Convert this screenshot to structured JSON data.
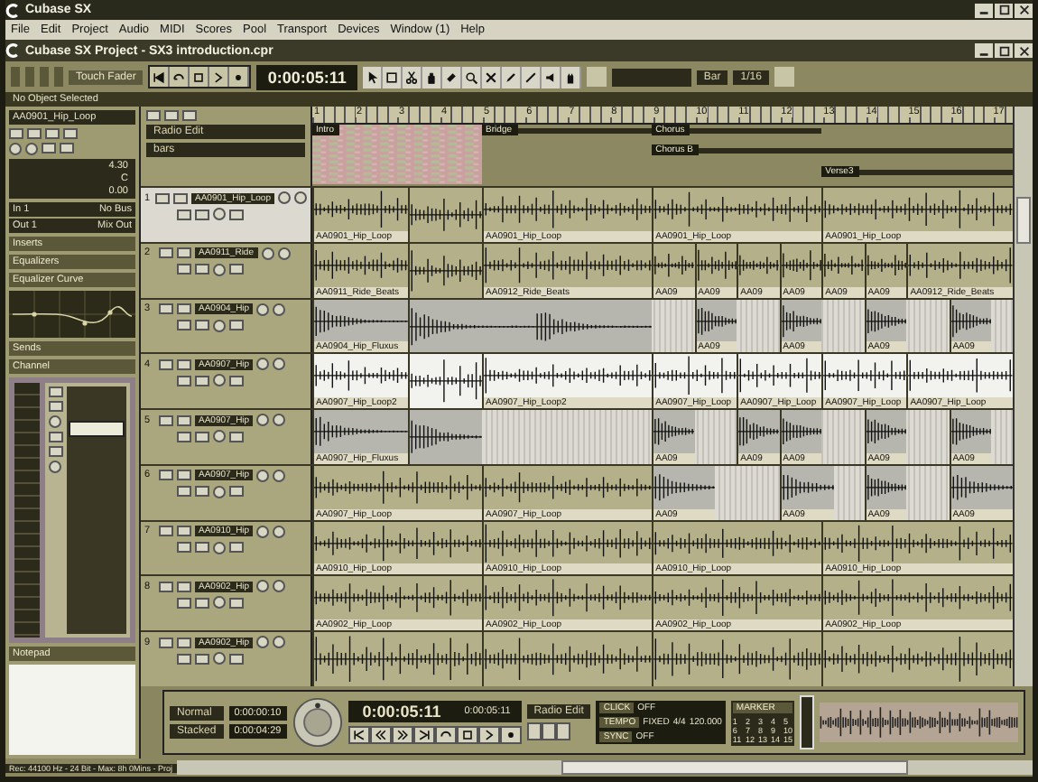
{
  "app_window": {
    "title": "Cubase SX"
  },
  "menu": [
    "File",
    "Edit",
    "Project",
    "Audio",
    "MIDI",
    "Scores",
    "Pool",
    "Transport",
    "Devices",
    "Window (1)",
    "Help"
  ],
  "project_window": {
    "title": "Cubase SX Project - SX3 introduction.cpr"
  },
  "toolbar": {
    "automation_mode": "Touch Fader",
    "time_display": "0:00:05:11",
    "grid_type": "Bar",
    "quantize": "1/16"
  },
  "info_line": "No Object Selected",
  "inspector": {
    "track_name": "AA0901_Hip_Loop",
    "volume": "4.30",
    "pan": "C",
    "delay": "0.00",
    "input": "In 1",
    "input_bus": "No Bus",
    "output": "Out 1",
    "output_bus": "Mix Out",
    "sections": [
      {
        "label": "Inserts",
        "kind": "section"
      },
      {
        "label": "Equalizers",
        "kind": "section"
      },
      {
        "label": "Equalizer Curve",
        "kind": "curve"
      },
      {
        "label": "Sends",
        "kind": "section"
      },
      {
        "label": "Channel",
        "kind": "channel"
      }
    ],
    "fader": {
      "level": 0.85
    },
    "notepad": "Notepad"
  },
  "track_list_header": {
    "preset": "Radio Edit",
    "zoom": "bars"
  },
  "ruler": [
    "1",
    "2",
    "3",
    "4",
    "5",
    "6",
    "7",
    "8",
    "9",
    "10",
    "11",
    "12",
    "13",
    "14",
    "15",
    "16",
    "17"
  ],
  "marker_rows": [
    [
      {
        "label": "Intro",
        "kind": "cycle"
      },
      {
        "label": "Bridge",
        "kind": "marker"
      },
      {
        "label": "Chorus",
        "kind": "marker"
      }
    ],
    [
      {
        "label": "Chorus B",
        "kind": "marker"
      }
    ],
    [
      {
        "label": "Verse3",
        "kind": "marker"
      }
    ]
  ],
  "tracks": [
    {
      "number": "1",
      "name": "AA0901_Hip_Loop",
      "selected": true,
      "events": [
        {
          "label": "AA0901_Hip_Loop",
          "kind": "loop",
          "selected": false
        },
        {
          "kind": "loop",
          "selected": false
        },
        {
          "label": "AA0901_Hip_Loop",
          "kind": "loop",
          "selected": false
        },
        {
          "label": "AA0901_Hip_Loop",
          "kind": "loop",
          "selected": false
        },
        {
          "label": "AA0901_Hip_Loop",
          "kind": "loop",
          "selected": false
        }
      ]
    },
    {
      "number": "2",
      "name": "AA0911_Ride",
      "selected": false,
      "events": [
        {
          "label": "AA0911_Ride_Beats",
          "kind": "loop",
          "selected": false
        },
        {
          "kind": "loop",
          "selected": false
        },
        {
          "label": "AA0912_Ride_Beats",
          "kind": "loop",
          "selected": false
        },
        {
          "label": "AA09",
          "kind": "loop",
          "selected": false
        },
        {
          "label": "AA09",
          "kind": "loop",
          "selected": false
        },
        {
          "label": "AA09",
          "kind": "loop",
          "selected": false
        },
        {
          "label": "AA09",
          "kind": "loop",
          "selected": false
        },
        {
          "label": "AA09",
          "kind": "loop",
          "selected": false
        },
        {
          "label": "AA09",
          "kind": "loop",
          "selected": false
        },
        {
          "label": "AA0912_Ride_Beats",
          "kind": "loop",
          "selected": false
        }
      ]
    },
    {
      "number": "3",
      "name": "AA0904_Hip",
      "selected": false,
      "events": [
        {
          "label": "AA0904_Hip_Fluxus",
          "kind": "hit",
          "selected": false
        },
        {
          "kind": "hit",
          "selected": false
        },
        {
          "label": "AA09",
          "kind": "hit",
          "selected": false
        },
        {
          "label": "AA09",
          "kind": "hit",
          "selected": false
        },
        {
          "label": "AA09",
          "kind": "hit",
          "selected": false
        },
        {
          "label": "AA09",
          "kind": "hit",
          "selected": false
        }
      ]
    },
    {
      "number": "4",
      "name": "AA0907_Hip",
      "selected": false,
      "events": [
        {
          "label": "AA0907_Hip_Loop2",
          "kind": "loop",
          "selected": true
        },
        {
          "kind": "loop",
          "selected": true
        },
        {
          "label": "AA0907_Hip_Loop2",
          "kind": "loop",
          "selected": true
        },
        {
          "label": "AA0907_Hip_Loop",
          "kind": "loop",
          "selected": true
        },
        {
          "label": "AA0907_Hip_Loop",
          "kind": "loop",
          "selected": true
        },
        {
          "label": "AA0907_Hip_Loop",
          "kind": "loop",
          "selected": true
        },
        {
          "label": "AA0907_Hip_Loop",
          "kind": "loop",
          "selected": true
        }
      ]
    },
    {
      "number": "5",
      "name": "AA0907_Hip",
      "selected": false,
      "events": [
        {
          "label": "AA0907_Hip_Fluxus",
          "kind": "hit",
          "selected": false
        },
        {
          "kind": "hit",
          "selected": false
        },
        {
          "label": "AA09",
          "kind": "hit",
          "selected": false
        },
        {
          "label": "AA09",
          "kind": "hit",
          "selected": false
        },
        {
          "label": "AA09",
          "kind": "hit",
          "selected": false
        },
        {
          "label": "AA09",
          "kind": "hit",
          "selected": false
        },
        {
          "label": "AA09",
          "kind": "hit",
          "selected": false
        }
      ]
    },
    {
      "number": "6",
      "name": "AA0907_Hip",
      "selected": false,
      "events": [
        {
          "label": "AA0907_Hip_Loop",
          "kind": "loop",
          "selected": false
        },
        {
          "label": "AA0907_Hip_Loop",
          "kind": "loop",
          "selected": false
        },
        {
          "label": "AA09",
          "kind": "hit",
          "selected": false
        },
        {
          "label": "AA09",
          "kind": "hit",
          "selected": false
        },
        {
          "label": "AA09",
          "kind": "hit",
          "selected": false
        },
        {
          "label": "AA09",
          "kind": "hit",
          "selected": false
        }
      ]
    },
    {
      "number": "7",
      "name": "AA0910_Hip",
      "selected": false,
      "events": [
        {
          "label": "AA0910_Hip_Loop",
          "kind": "loop",
          "selected": false
        },
        {
          "label": "AA0910_Hip_Loop",
          "kind": "loop",
          "selected": false
        },
        {
          "label": "AA0910_Hip_Loop",
          "kind": "loop",
          "selected": false
        },
        {
          "label": "AA0910_Hip_Loop",
          "kind": "loop",
          "selected": false
        }
      ]
    },
    {
      "number": "8",
      "name": "AA0902_Hip",
      "selected": false,
      "events": [
        {
          "label": "AA0902_Hip_Loop",
          "kind": "loop",
          "selected": false
        },
        {
          "label": "AA0902_Hip_Loop",
          "kind": "loop",
          "selected": false
        },
        {
          "label": "AA0902_Hip_Loop",
          "kind": "loop",
          "selected": false
        },
        {
          "label": "AA0902_Hip_Loop",
          "kind": "loop",
          "selected": false
        }
      ]
    },
    {
      "number": "9",
      "name": "AA0902_Hip",
      "selected": false,
      "events": [
        {
          "kind": "loop",
          "selected": false
        },
        {
          "kind": "loop",
          "selected": false
        },
        {
          "kind": "loop",
          "selected": false
        },
        {
          "kind": "loop",
          "selected": false
        }
      ]
    }
  ],
  "transport": {
    "mode_1": "Normal",
    "mode_2": "Stacked",
    "left_locator": "0:00:00:10",
    "right_locator": "0:00:04:29",
    "position": "0:00:05:11",
    "position_2": "0:00:05:11",
    "preset": "Radio Edit",
    "click_label": "CLICK",
    "click": "OFF",
    "tempo_label": "TEMPO",
    "tempo": "FIXED",
    "signature": "4/4",
    "bpm": "120.000",
    "sync_label": "SYNC",
    "sync": "OFF",
    "marker_label": "MARKER",
    "marker_buttons": [
      "1",
      "2",
      "3",
      "4",
      "5",
      "6",
      "7",
      "8",
      "9",
      "10",
      "11",
      "12",
      "13",
      "14",
      "15"
    ]
  },
  "status_bar": "Rec: 44100 Hz - 24 Bit - Max: 8h 0Mins - Proj"
}
